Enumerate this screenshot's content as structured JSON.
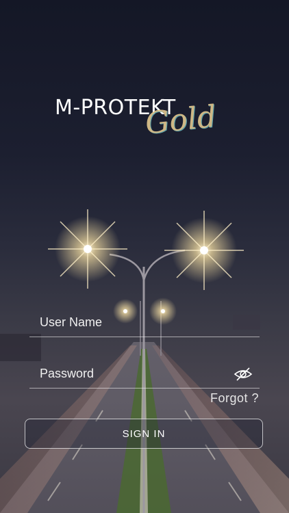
{
  "brand": {
    "name": "M-PROTEKT",
    "script": "Gold"
  },
  "login": {
    "username_label": "User Name",
    "password_label": "Password",
    "forgot_label": "Forgot ?",
    "signin_label": "SIGN IN"
  },
  "icons": {
    "password_toggle": "eye-off-icon"
  },
  "colors": {
    "background_top": "#141726",
    "background_bottom": "#3a3842",
    "gold": "#d8c08a",
    "text": "#ffffff"
  }
}
